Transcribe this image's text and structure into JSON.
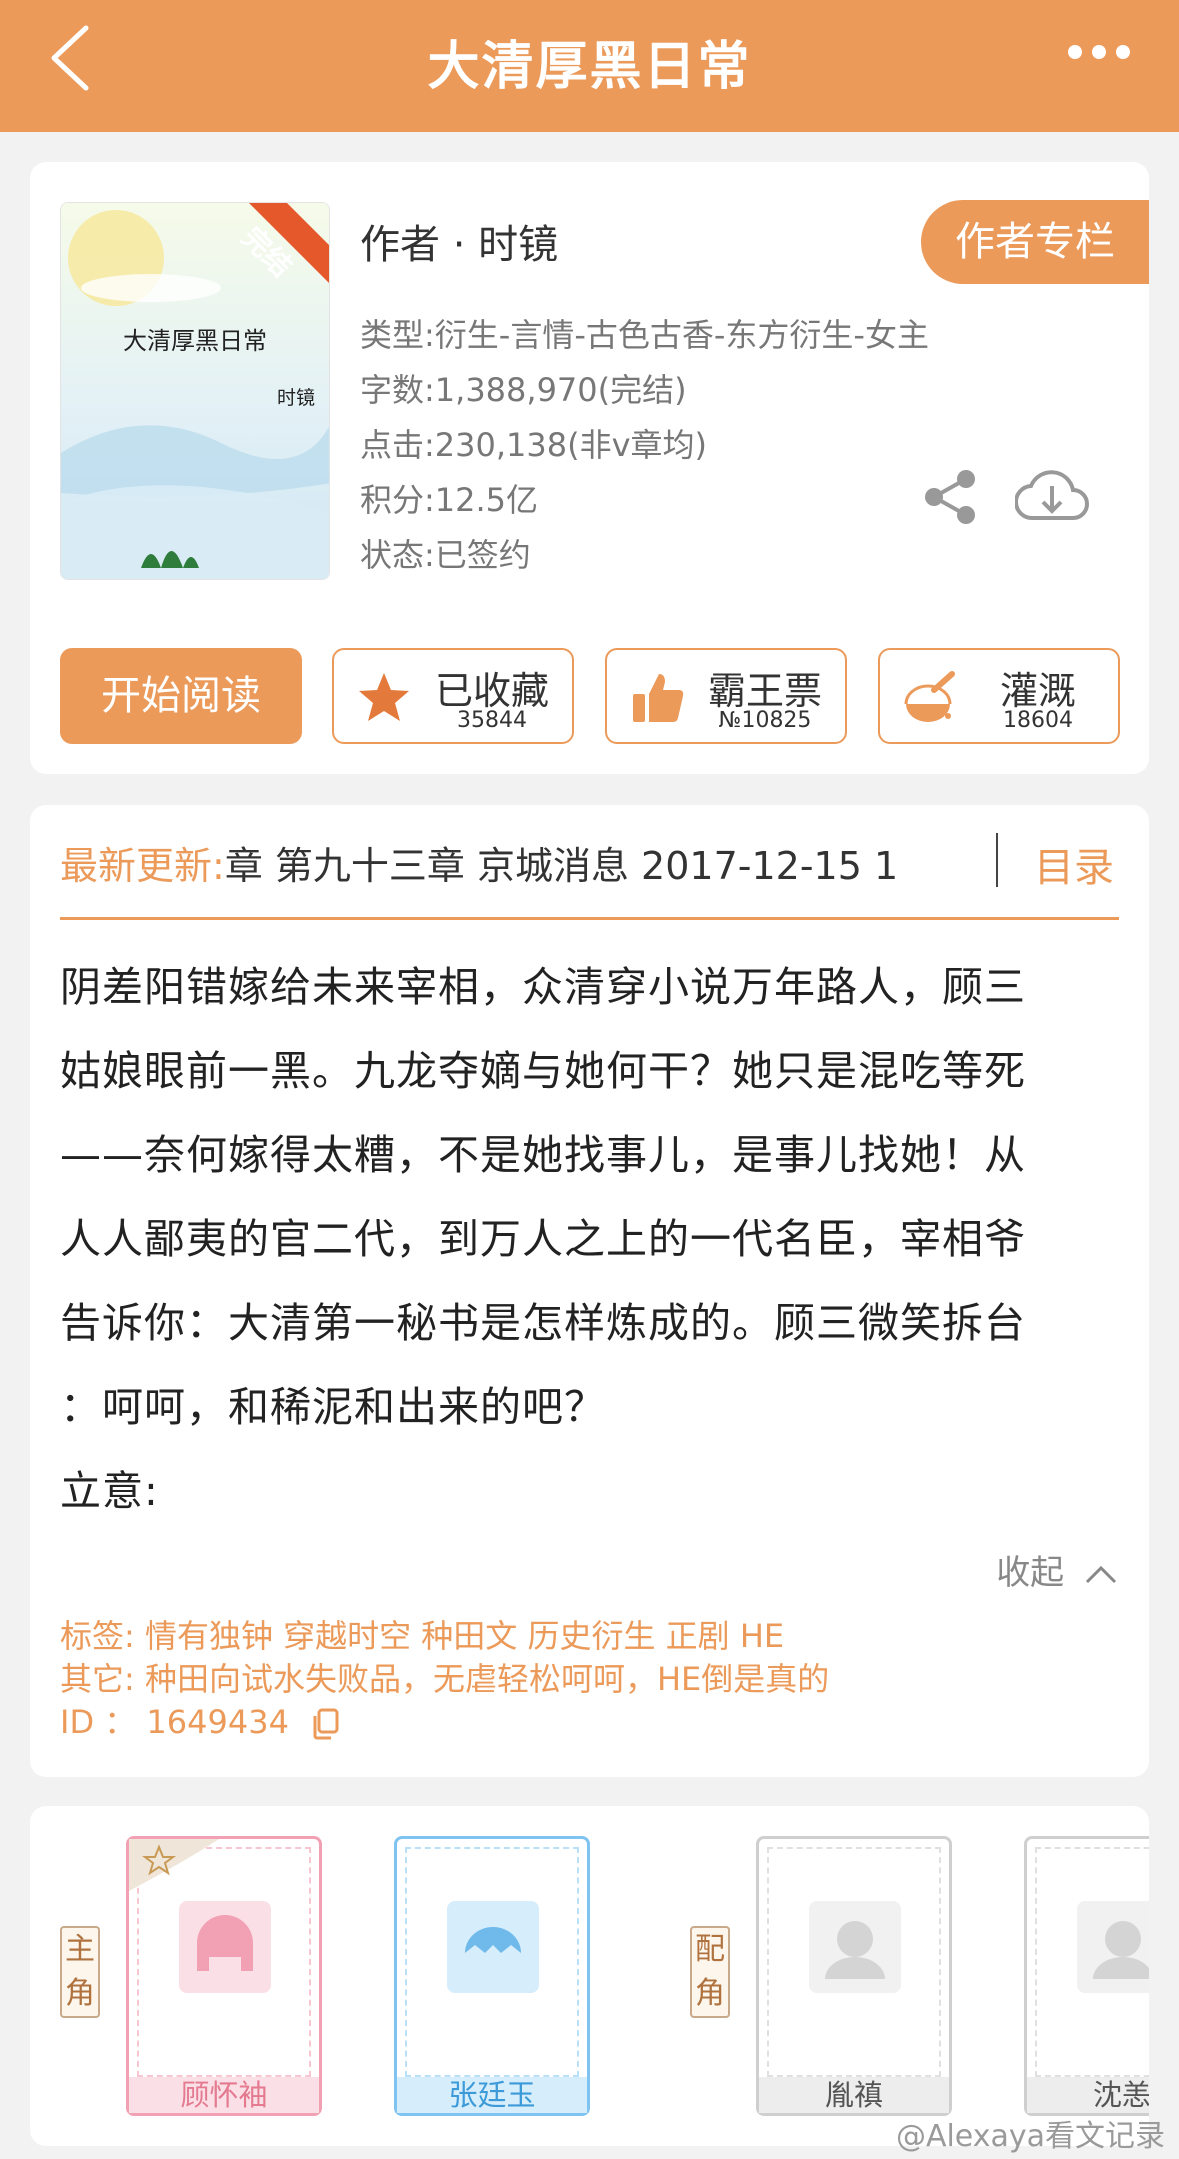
{
  "header": {
    "title": "大清厚黑日常",
    "back_icon": "chevron-left-icon",
    "more_icon": "more-dots-icon"
  },
  "cover": {
    "title": "大清厚黑日常",
    "author": "时镜",
    "ribbon": "完结",
    "publisher_logo": "jjwxc-logo"
  },
  "book": {
    "author_line": "作者 · 时镜",
    "author_column_button": "作者专栏",
    "type": "类型:衍生-言情-古色古香-东方衍生-女主",
    "words": "字数:1,388,970(完结)",
    "clicks": "点击:230,138(非v章均)",
    "score": "积分:12.5亿",
    "status": "状态:已签约"
  },
  "actions": {
    "read": "开始阅读",
    "favorite": {
      "label": "已收藏",
      "count": "35844"
    },
    "ticket": {
      "label": "霸王票",
      "count": "№10825"
    },
    "nutrient": {
      "label": "灌溉",
      "count": "18604"
    }
  },
  "update": {
    "label": "最新更新:",
    "text": "章 第九十三章 京城消息 2017-12-15 1",
    "toc": "目录"
  },
  "description": [
    "阴差阳错嫁给未来宰相，众清穿小说万年路人，顾三",
    "姑娘眼前一黑。九龙夺嫡与她何干？她只是混吃等死",
    "——奈何嫁得太糟，不是她找事儿，是事儿找她！从",
    "人人鄙夷的官二代，到万人之上的一代名臣，宰相爷",
    "告诉你：大清第一秘书是怎样炼成的。顾三微笑拆台",
    "：呵呵，和稀泥和出来的吧？",
    "立意:"
  ],
  "collapse": "收起",
  "tags": {
    "tags_line": "标签: 情有独钟  穿越时空  种田文  历史衍生  正剧  HE",
    "other_line": "其它:  种田向试水失败品，无虐轻松呵呵，HE倒是真的",
    "id_line": "ID   ：  1649434"
  },
  "roles": {
    "main_label": "主角",
    "support_label": "配角",
    "characters": [
      {
        "name": "顾怀袖",
        "color": "#f2a0b4"
      },
      {
        "name": "张廷玉",
        "color": "#7fc3f0"
      },
      {
        "name": "胤禛",
        "color": "#c4c4c4"
      },
      {
        "name": "沈恙",
        "color": "#c4c4c4"
      }
    ]
  },
  "watermark": "@Alexaya看文记录",
  "colors": {
    "accent": "#eb9a5a",
    "background": "#f2f2f2"
  }
}
